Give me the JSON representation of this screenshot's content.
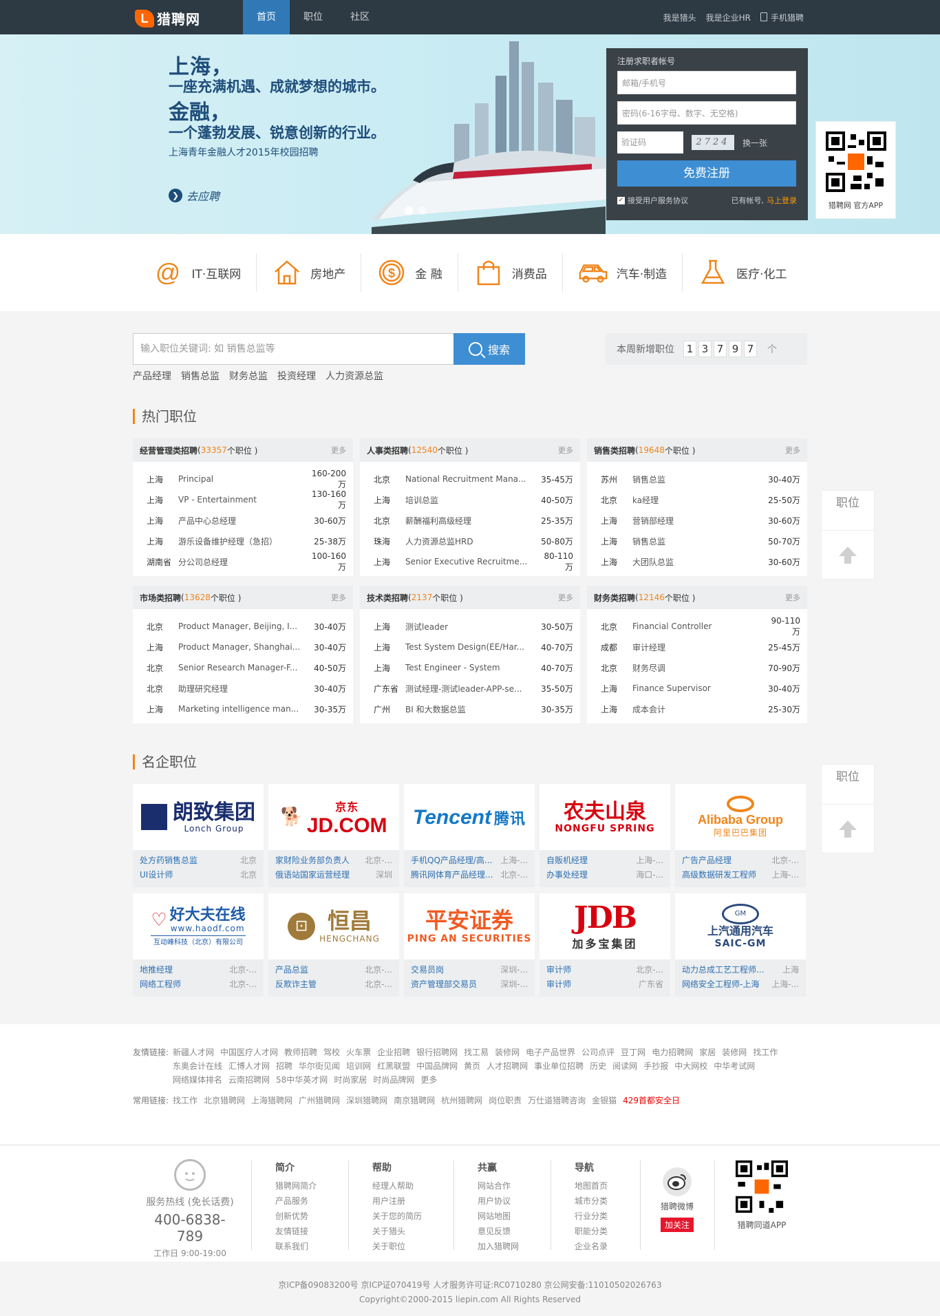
{
  "header": {
    "logo_text": "猎聘网",
    "nav": [
      "首页",
      "职位",
      "社区"
    ],
    "links": {
      "headhunter": "我是猎头",
      "hr": "我是企业HR",
      "mobile": "手机猎聘"
    }
  },
  "banner": {
    "line1": "上海，",
    "line2": "一座充满机遇、成就梦想的城市。",
    "line3": "金融，",
    "line4": "一个蓬勃发展、锐意创新的行业。",
    "subtitle": "上海青年金融人才2015年校园招聘",
    "cta": "去应聘"
  },
  "register": {
    "title": "注册求职者帐号",
    "email_placeholder": "邮箱/手机号",
    "password_placeholder": "密码(6-16字母、数字、无空格)",
    "code_placeholder": "验证码",
    "captcha": "2724",
    "change": "换一张",
    "submit": "免费注册",
    "agree": "接受用户服务协议",
    "has_account": "已有帐号,",
    "login": "马上登录"
  },
  "app_qr": {
    "label": "猎聘网 官方APP"
  },
  "categories": [
    {
      "icon": "at-icon",
      "label": "IT·互联网"
    },
    {
      "icon": "house-icon",
      "label": "房地产"
    },
    {
      "icon": "dollar-coin-icon",
      "label": "金 融"
    },
    {
      "icon": "shopping-bag-icon",
      "label": "消费品"
    },
    {
      "icon": "car-icon",
      "label": "汽车·制造"
    },
    {
      "icon": "flask-icon",
      "label": "医疗·化工"
    }
  ],
  "search": {
    "placeholder": "输入职位关键词: 如 销售总监等",
    "button": "搜索",
    "hot": [
      "产品经理",
      "销售总监",
      "财务总监",
      "投资经理",
      "人力资源总监"
    ]
  },
  "weekly": {
    "label": "本周新增职位",
    "digits": [
      "1",
      "3",
      "7",
      "9",
      "7"
    ],
    "unit": "个"
  },
  "hot_jobs": {
    "title": "热门职位",
    "more": "更多",
    "unit": "个职位",
    "cards": [
      {
        "name": "经营管理类招聘",
        "count": "33357",
        "rows": [
          [
            "上海",
            "Principal",
            "160-200万"
          ],
          [
            "上海",
            "VP - Entertainment",
            "130-160万"
          ],
          [
            "上海",
            "产品中心总经理",
            "30-60万"
          ],
          [
            "上海",
            "游乐设备维护经理（急招）",
            "25-38万"
          ],
          [
            "湖南省",
            "分公司总经理",
            "100-160万"
          ]
        ]
      },
      {
        "name": "人事类招聘",
        "count": "12540",
        "rows": [
          [
            "北京",
            "National Recruitment Mana...",
            "35-45万"
          ],
          [
            "上海",
            "培训总监",
            "40-50万"
          ],
          [
            "北京",
            "薪酬福利高级经理",
            "25-35万"
          ],
          [
            "珠海",
            "人力资源总监HRD",
            "50-80万"
          ],
          [
            "上海",
            "Senior Executive Recruitme...",
            "80-110万"
          ]
        ]
      },
      {
        "name": "销售类招聘",
        "count": "19648",
        "rows": [
          [
            "苏州",
            "销售总监",
            "30-40万"
          ],
          [
            "北京",
            "ka经理",
            "25-50万"
          ],
          [
            "上海",
            "营销部经理",
            "30-60万"
          ],
          [
            "上海",
            "销售总监",
            "50-70万"
          ],
          [
            "上海",
            "大团队总监",
            "30-60万"
          ]
        ]
      },
      {
        "name": "市场类招聘",
        "count": "13628",
        "rows": [
          [
            "北京",
            "Product Manager, Beijing, I...",
            "30-40万"
          ],
          [
            "上海",
            "Product Manager, Shanghai...",
            "30-40万"
          ],
          [
            "北京",
            "Senior Research Manager-F...",
            "40-50万"
          ],
          [
            "北京",
            "助理研究经理",
            "30-40万"
          ],
          [
            "上海",
            "Marketing intelligence man...",
            "30-35万"
          ]
        ]
      },
      {
        "name": "技术类招聘",
        "count": "2137",
        "rows": [
          [
            "上海",
            "测试leader",
            "30-50万"
          ],
          [
            "上海",
            "Test System Design(EE/Har...",
            "40-70万"
          ],
          [
            "上海",
            "Test Engineer - System",
            "40-70万"
          ],
          [
            "广东省",
            "测试经理-测试leader-APP-se...",
            "35-50万"
          ],
          [
            "广州",
            "BI 和大数据总监",
            "30-35万"
          ]
        ]
      },
      {
        "name": "财务类招聘",
        "count": "12146",
        "rows": [
          [
            "北京",
            "Financial Controller",
            "90-110万"
          ],
          [
            "成都",
            "审计经理",
            "25-45万"
          ],
          [
            "北京",
            "财务尽调",
            "70-90万"
          ],
          [
            "上海",
            "Finance Supervisor",
            "30-40万"
          ],
          [
            "上海",
            "成本会计",
            "25-30万"
          ]
        ]
      }
    ]
  },
  "side_float": {
    "label": "职位"
  },
  "famous": {
    "title": "名企职位",
    "companies": [
      {
        "logo_main": "朗致集团",
        "logo_sub": "Lonch Group",
        "color": "#1a2e6e",
        "jobs": [
          [
            "处方药销售总监",
            "北京"
          ],
          [
            "UI设计师",
            "北京"
          ]
        ]
      },
      {
        "logo_main": "JD.COM",
        "logo_sub": "京东",
        "color": "#d7000f",
        "jobs": [
          [
            "家财险业务部负责人",
            "北京-..."
          ],
          [
            "俄语站国家运营经理",
            "深圳"
          ]
        ]
      },
      {
        "logo_main": "Tencent",
        "logo_sub": "腾讯",
        "color": "#1478c8",
        "jobs": [
          [
            "手机QQ产品经理/高...",
            "上海-..."
          ],
          [
            "腾讯网体育产品经理...",
            "北京-..."
          ]
        ]
      },
      {
        "logo_main": "农夫山泉",
        "logo_sub": "NONGFU SPRING",
        "color": "#d7000f",
        "jobs": [
          [
            "自贩机经理",
            "上海-..."
          ],
          [
            "办事处经理",
            "海口-..."
          ]
        ]
      },
      {
        "logo_main": "Alibaba Group",
        "logo_sub": "阿里巴巴集团",
        "color": "#f08519",
        "jobs": [
          [
            "广告产品经理",
            "北京-..."
          ],
          [
            "高级数据研发工程师",
            "上海-..."
          ]
        ]
      },
      {
        "logo_main": "好大夫在线",
        "logo_sub": "www.haodf.com",
        "logo_sub2": "互动峰科技（北京）有限公司",
        "color": "#1e5ba8",
        "jobs": [
          [
            "地推经理",
            "北京-..."
          ],
          [
            "网络工程师",
            "北京-..."
          ]
        ]
      },
      {
        "logo_main": "恒昌",
        "logo_sub": "HENGCHANG",
        "color": "#a07a3a",
        "jobs": [
          [
            "产品总监",
            "北京-..."
          ],
          [
            "反欺诈主管",
            "北京-..."
          ]
        ]
      },
      {
        "logo_main": "平安证券",
        "logo_sub": "PING AN SECURITIES",
        "color": "#f05a22",
        "jobs": [
          [
            "交易员岗",
            "深圳-..."
          ],
          [
            "资产管理部交易员",
            "深圳-..."
          ]
        ]
      },
      {
        "logo_main": "JDB",
        "logo_sub": "加多宝集团",
        "color": "#d7000f",
        "jobs": [
          [
            "审计师",
            "北京-..."
          ],
          [
            "审计师",
            "广东省"
          ]
        ]
      },
      {
        "logo_main": "上汽通用汽车",
        "logo_sub": "SAIC-GM",
        "color": "#2b4a7d",
        "jobs": [
          [
            "动力总成工艺工程师...",
            "上海"
          ],
          [
            "网络安全工程师-上海",
            "上海-..."
          ]
        ]
      }
    ]
  },
  "links": {
    "friend_label": "友情链接:",
    "friend": [
      "新疆人才网",
      "中国医疗人才网",
      "教师招聘",
      "驾校",
      "火车票",
      "企业招聘",
      "银行招聘网",
      "找工易",
      "装修网",
      "电子产品世界",
      "公司点评",
      "豆丁网",
      "电力招聘网",
      "家居",
      "装修网",
      "找工作",
      "东奥会计在线",
      "汇博人才网",
      "招聘",
      "华尔街见闻",
      "培训网",
      "红黑联盟",
      "中国品牌网",
      "黄页",
      "人才招聘网",
      "事业单位招聘",
      "历史",
      "阅读网",
      "手抄报",
      "中大网校",
      "中华考试网",
      "网络媒体排名",
      "云南招聘网",
      "58中华英才网",
      "时尚家居",
      "时尚品牌网",
      "更多"
    ],
    "common_label": "常用链接:",
    "common": [
      "找工作",
      "北京猎聘网",
      "上海猎聘网",
      "广州猎聘网",
      "深圳猎聘网",
      "南京猎聘网",
      "杭州猎聘网",
      "岗位职责",
      "万仕道猎聘咨询",
      "金银猫"
    ],
    "common_red": "429首都安全日"
  },
  "footer": {
    "service_label": "服务热线 (免长话费)",
    "phone": "400-6838-789",
    "hours": "工作日 9:00-19:00",
    "columns": [
      {
        "title": "简介",
        "items": [
          "猎聘网简介",
          "产品服务",
          "创新优势",
          "友情链接",
          "联系我们"
        ]
      },
      {
        "title": "帮助",
        "items": [
          "经理人帮助",
          "用户注册",
          "关于您的简历",
          "关于猎头",
          "关于职位"
        ]
      },
      {
        "title": "共赢",
        "items": [
          "网站合作",
          "用户协议",
          "网站地图",
          "意见反馈",
          "加入猎聘网"
        ]
      },
      {
        "title": "导航",
        "items": [
          "地图首页",
          "城市分类",
          "行业分类",
          "职能分类",
          "企业名录"
        ]
      }
    ],
    "weibo": "猎聘微博",
    "follow": "加关注",
    "app": "猎聘同道APP",
    "icp": "京ICP备09083200号 京ICP证070419号 人才服务许可证:RC0710280 京公网安备:11010502026763",
    "copyright": "Copyright©2000-2015 liepin.com All Rights Reserved"
  }
}
